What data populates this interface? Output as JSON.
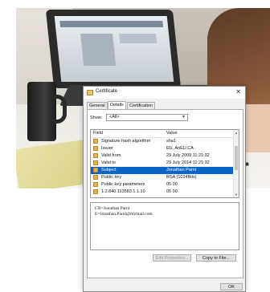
{
  "dialog": {
    "title": "Certificate",
    "close_glyph": "✕",
    "tabs": [
      {
        "label": "General"
      },
      {
        "label": "Details"
      },
      {
        "label": "Certification Path"
      }
    ],
    "show_label": "Show:",
    "show_value": "<All>",
    "columns": {
      "field": "Field",
      "value": "Value"
    },
    "rows": [
      {
        "field": "Signature hash algorithm",
        "value": "sha1"
      },
      {
        "field": "Issuer",
        "value": "EU, AnEU CA"
      },
      {
        "field": "Valid from",
        "value": "29 July 2009 11:21:32"
      },
      {
        "field": "Valid to",
        "value": "29 July 2014 11:21:32"
      },
      {
        "field": "Subject",
        "value": "Jonathan Parni"
      },
      {
        "field": "Public key",
        "value": "RSA (1024Bits)"
      },
      {
        "field": "Public key parameters",
        "value": "05 00"
      },
      {
        "field": "1.2.840.113583.1.1.10",
        "value": "05 00"
      }
    ],
    "selected_row": "Subject",
    "detail_lines": [
      "CN=Jonathan Parni",
      "E=Jonathan.Parni@mymail.com"
    ],
    "edit_properties_label": "Edit Properties...",
    "copy_to_file_label": "Copy to File...",
    "ok_label": "OK"
  },
  "icons": {
    "certificate": "certificate-icon",
    "field": "certificate-field-icon",
    "dropdown": "chevron-down-icon"
  },
  "colors": {
    "selection": "#0a64c8",
    "dialog_bg": "#f0f0f0"
  }
}
